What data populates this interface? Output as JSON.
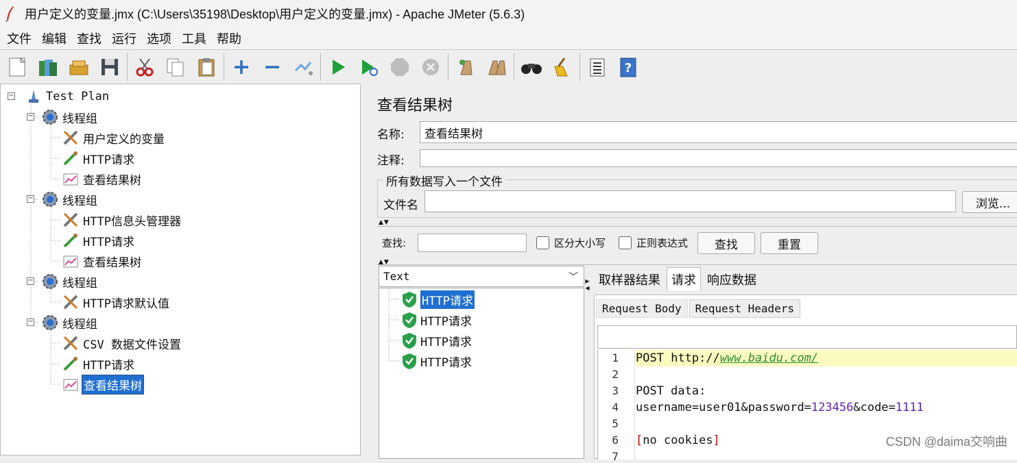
{
  "window": {
    "title": "用户定义的变量.jmx (C:\\Users\\35198\\Desktop\\用户定义的变量.jmx) - Apache JMeter (5.6.3)"
  },
  "menu": [
    "文件",
    "编辑",
    "查找",
    "运行",
    "选项",
    "工具",
    "帮助"
  ],
  "toolbar": [
    {
      "icon": "new-icon"
    },
    {
      "icon": "templates-icon"
    },
    {
      "icon": "open-icon"
    },
    {
      "icon": "save-icon"
    },
    {
      "icon": "cut-icon"
    },
    {
      "icon": "copy-icon"
    },
    {
      "icon": "paste-icon"
    },
    {
      "icon": "expand-icon"
    },
    {
      "icon": "collapse-icon"
    },
    {
      "icon": "toggle-icon"
    },
    {
      "icon": "start-icon"
    },
    {
      "icon": "start-no-pauses-icon"
    },
    {
      "icon": "stop-icon"
    },
    {
      "icon": "shutdown-icon"
    },
    {
      "icon": "clear-icon"
    },
    {
      "icon": "clear-all-icon"
    },
    {
      "icon": "search-icon"
    },
    {
      "icon": "reset-search-icon"
    },
    {
      "icon": "function-helper-icon"
    },
    {
      "icon": "help-icon"
    }
  ],
  "tree": {
    "root": "Test Plan",
    "groups": [
      {
        "label": "线程组",
        "children": [
          {
            "label": "用户定义的变量",
            "icon": "wrench-icon"
          },
          {
            "label": "HTTP请求",
            "icon": "pipette-icon"
          },
          {
            "label": "查看结果树",
            "icon": "graph-icon"
          }
        ]
      },
      {
        "label": "线程组",
        "children": [
          {
            "label": "HTTP信息头管理器",
            "icon": "wrench-icon"
          },
          {
            "label": "HTTP请求",
            "icon": "pipette-icon"
          },
          {
            "label": "查看结果树",
            "icon": "graph-icon"
          }
        ]
      },
      {
        "label": "线程组",
        "children": [
          {
            "label": "HTTP请求默认值",
            "icon": "wrench-icon"
          }
        ]
      },
      {
        "label": "线程组",
        "children": [
          {
            "label": "CSV 数据文件设置",
            "icon": "wrench-icon"
          },
          {
            "label": "HTTP请求",
            "icon": "pipette-icon"
          },
          {
            "label": "查看结果树",
            "icon": "graph-icon",
            "selected": true
          }
        ]
      }
    ]
  },
  "panel": {
    "title": "查看结果树",
    "name_label": "名称:",
    "name_value": "查看结果树",
    "comment_label": "注释:",
    "comment_value": "",
    "file_section": "所有数据写入一个文件",
    "file_label": "文件名",
    "browse": "浏览...",
    "search_label": "查找:",
    "case_sensitive": "区分大小写",
    "regex": "正则表达式",
    "find_button": "查找",
    "reset_button": "重置",
    "renderer": "Text",
    "results": [
      "HTTP请求",
      "HTTP请求",
      "HTTP请求",
      "HTTP请求"
    ],
    "tabs": [
      "取样器结果",
      "请求",
      "响应数据"
    ],
    "active_tab": "请求",
    "subtabs": [
      "Request Body",
      "Request Headers"
    ],
    "code": {
      "line1_method": "POST",
      "line1_url": "http://www.baidu.com/",
      "line3": "POST data:",
      "line4": "username=user01&password=123456&code=1111",
      "line6": "[no cookies]"
    },
    "line_numbers": [
      "1",
      "2",
      "3",
      "4",
      "5",
      "6",
      "7"
    ]
  },
  "watermark": "CSDN @daima交响曲",
  "colors": {
    "selection": "#1f6fd0",
    "highlight_line": "#fbfbc0",
    "url": "#2a8a2a",
    "number": "#5a1fb0",
    "bracket": "#c00000"
  }
}
